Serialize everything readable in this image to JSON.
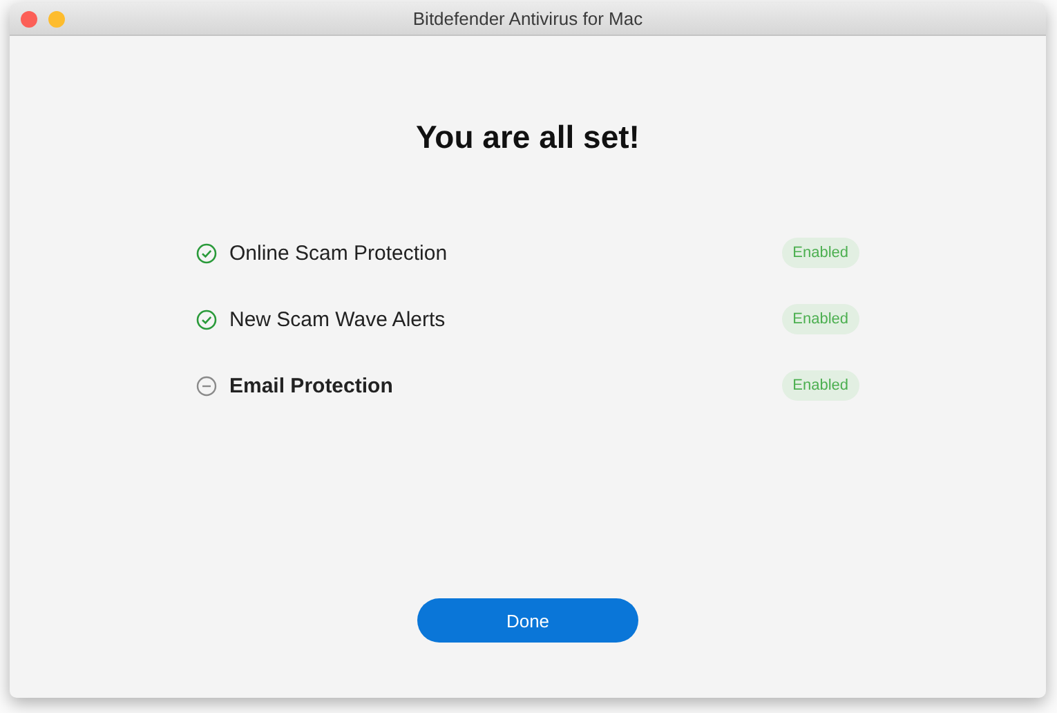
{
  "window": {
    "title": "Bitdefender Antivirus for Mac"
  },
  "heading": "You are all set!",
  "features": [
    {
      "name": "Online Scam Protection",
      "kind": "check",
      "highlighted": false,
      "status": "Enabled"
    },
    {
      "name": "New Scam Wave Alerts",
      "kind": "check",
      "highlighted": false,
      "status": "Enabled"
    },
    {
      "name": "Email Protection",
      "kind": "minus",
      "highlighted": true,
      "status": "Enabled"
    }
  ],
  "buttons": [
    "Done"
  ]
}
